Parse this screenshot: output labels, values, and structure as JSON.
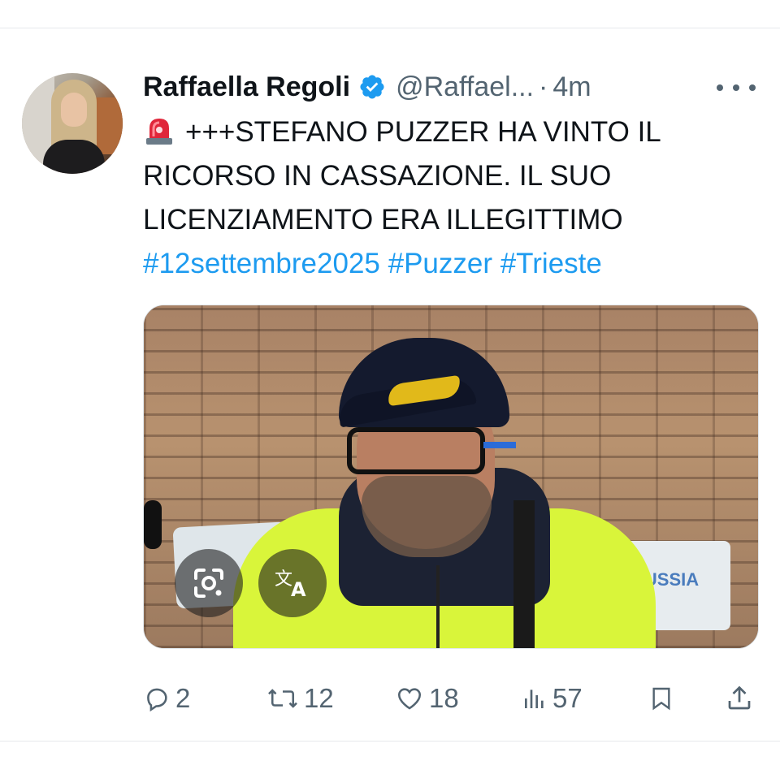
{
  "tweet": {
    "author_name": "Raffaella Regoli",
    "handle": "@Raffael...",
    "separator": "·",
    "time": "4m",
    "text_lines": [
      "+++STEFANO PUZZER HA VINTO IL",
      "RICORSO IN CASSAZIONE. IL SUO",
      "LICENZIAMENTO ERA ILLEGITTIMO"
    ],
    "hashtags": "#12settembre2025 #Puzzer #Trieste",
    "media": {
      "sign_right_text": "RUSSIA"
    }
  },
  "icons": {
    "verified": "verified-badge-icon",
    "more": "more-options-icon",
    "siren": "rotating-light-emoji",
    "lens": "google-lens-icon",
    "translate": "translate-icon",
    "reply": "reply-icon",
    "retweet": "retweet-icon",
    "like": "like-icon",
    "views": "views-icon",
    "bookmark": "bookmark-icon",
    "share": "share-icon"
  },
  "actions": {
    "replies": "2",
    "retweets": "12",
    "likes": "18",
    "views": "57"
  },
  "colors": {
    "link": "#1d9bf0",
    "secondary_text": "#536471",
    "verified": "#1d9bf0"
  }
}
